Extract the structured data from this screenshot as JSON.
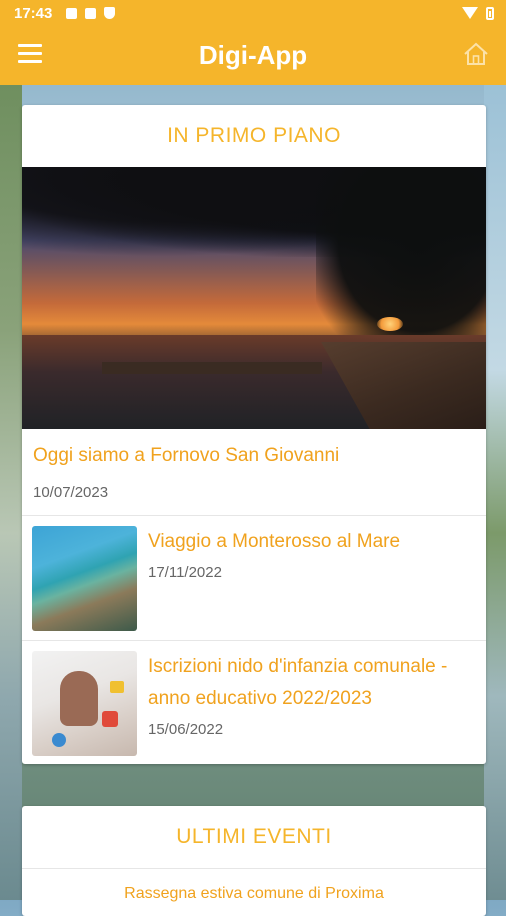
{
  "status_bar": {
    "time": "17:43"
  },
  "app_bar": {
    "title": "Digi-App"
  },
  "featured_section": {
    "heading": "IN PRIMO PIANO",
    "top_story": {
      "title": "Oggi siamo a Fornovo San Giovanni",
      "date": "10/07/2023"
    },
    "stories": [
      {
        "title": "Viaggio a Monterosso al Mare",
        "date": "17/11/2022"
      },
      {
        "title": "Iscrizioni nido d'infanzia comunale - anno educativo 2022/2023",
        "date": "15/06/2022"
      }
    ]
  },
  "events_section": {
    "heading": "ULTIMI EVENTI",
    "first_event": "Rassegna estiva comune di Proxima"
  },
  "colors": {
    "accent": "#f5b52b",
    "title_text": "#f0a21e"
  },
  "icons": [
    "menu-icon",
    "home-icon",
    "image-icon",
    "notification-icon",
    "shield-icon",
    "wifi-icon",
    "battery-icon"
  ]
}
